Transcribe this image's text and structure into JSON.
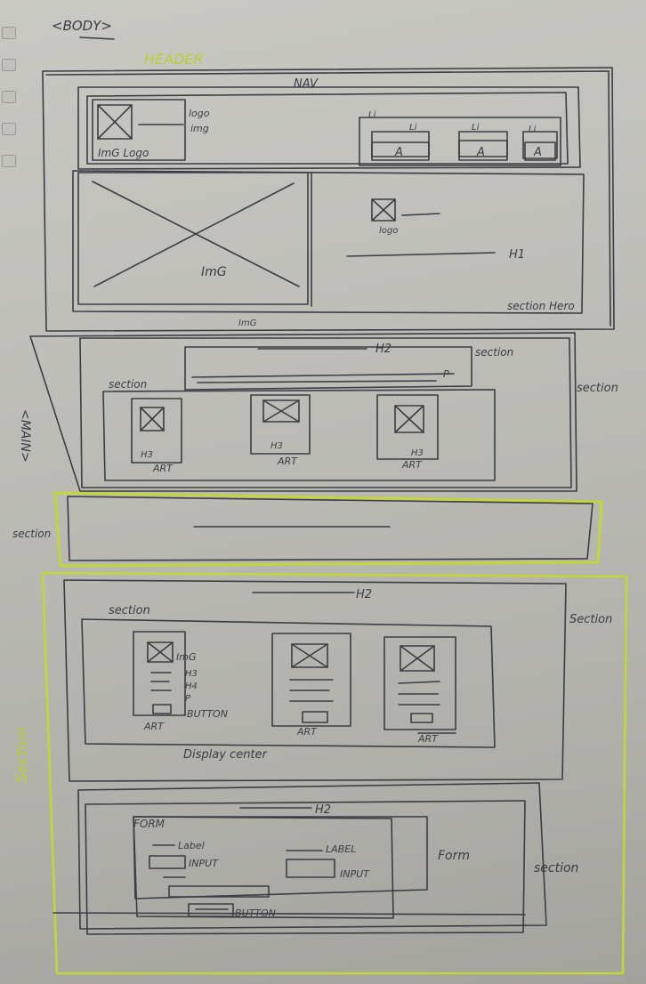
{
  "labels": {
    "body": "<BODY>",
    "header": "HEADER",
    "nav": "NAV",
    "logo": "logo",
    "img_small": "img",
    "img_logo": "ImG Logo",
    "li": "Li",
    "link": "A",
    "img": "ImG",
    "logo_small": "logo",
    "h1": "H1",
    "img_caption": "ImG",
    "section_hero": "section Hero",
    "h2": "H2",
    "p": "P",
    "section": "section",
    "main": "<MAIN>",
    "h3": "H3",
    "art": "ART",
    "section_side": "Section",
    "img_card": "ImG",
    "h4": "H4",
    "button": "BUTTON",
    "display_center": "Display center",
    "form": "FORM",
    "label": "Label",
    "label_caps": "LABEL",
    "input": "INPUT",
    "form_side": "Form",
    "section_big": "Section"
  },
  "colors": {
    "ink": "#3c3c44",
    "highlighter": "#c4d53a"
  }
}
